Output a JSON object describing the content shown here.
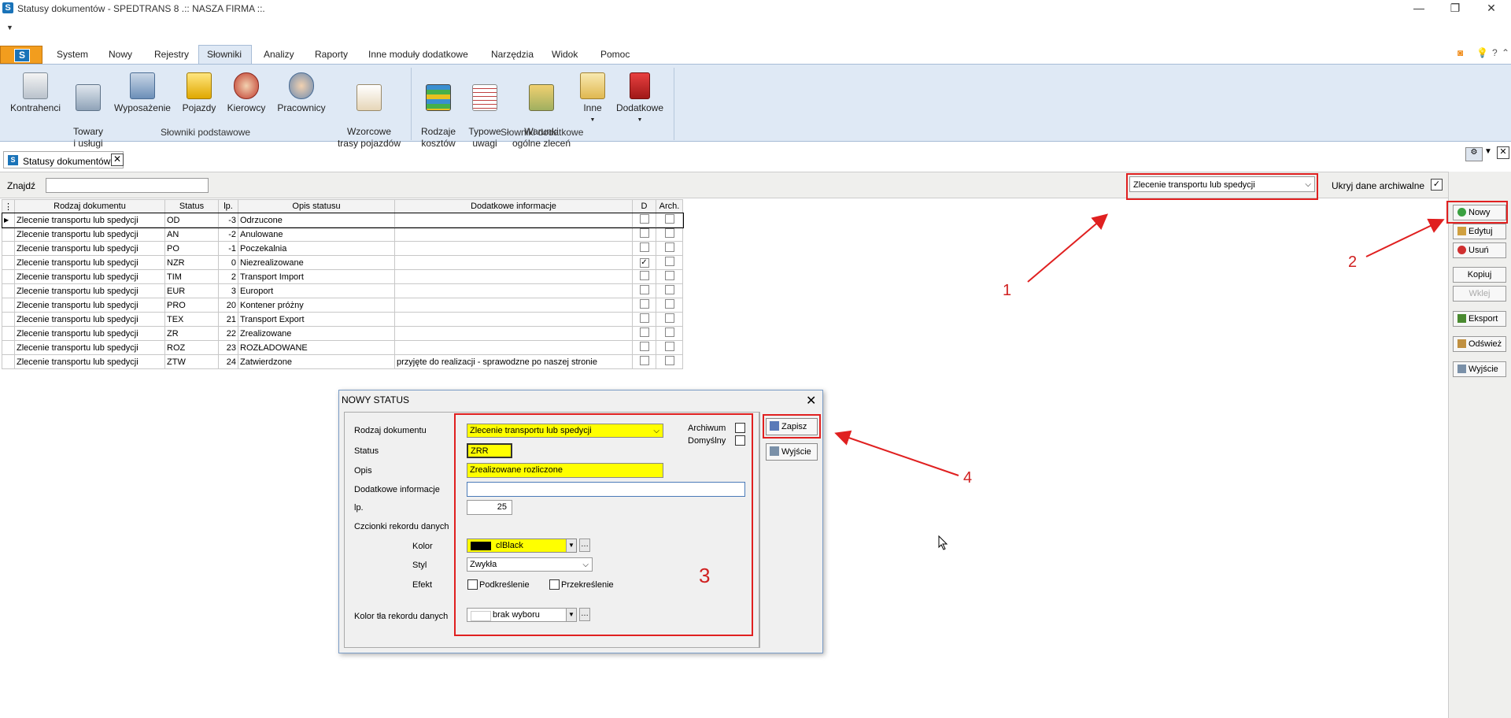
{
  "window": {
    "title": "Statusy dokumentów - SPEDTRANS 8 .:: NASZA FIRMA ::.",
    "minimize": "—",
    "restore": "❐",
    "close": "✕"
  },
  "ribbon": {
    "tabs": [
      "System",
      "Nowy",
      "Rejestry",
      "Słowniki",
      "Analizy",
      "Raporty",
      "Inne moduły dodatkowe",
      "Narzędzia",
      "Widok",
      "Pomoc"
    ],
    "active_tab": "Słowniki",
    "buttons": [
      {
        "label": "Kontrahenci",
        "icon": "book-icon"
      },
      {
        "label": "Towary\ni usługi",
        "icon": "goods-icon"
      },
      {
        "label": "Wyposażenie",
        "icon": "equipment-icon"
      },
      {
        "label": "Pojazdy",
        "icon": "truck-icon"
      },
      {
        "label": "Kierowcy",
        "icon": "driver-icon"
      },
      {
        "label": "Pracownicy",
        "icon": "employees-icon"
      },
      {
        "label": "Wzorcowe\ntrasy pojazdów",
        "icon": "route-icon"
      },
      {
        "label": "Rodzaje\nkosztów",
        "icon": "costs-icon"
      },
      {
        "label": "Typowe\nuwagi",
        "icon": "notes-icon"
      },
      {
        "label": "Warunki\nogólne zleceń",
        "icon": "handshake-icon"
      },
      {
        "label": "Inne",
        "icon": "folder-icon"
      },
      {
        "label": "Dodatkowe",
        "icon": "red-book-icon"
      }
    ],
    "groups": [
      "Słowniki podstawowe",
      "Słowniki dodatkowe"
    ]
  },
  "doc_tab": {
    "label": "Statusy dokumentów"
  },
  "filter": {
    "find_label": "Znajdź",
    "doc_type_selected": "Zlecenie transportu lub spedycji",
    "hide_archived_label": "Ukryj dane archiwalne",
    "hide_archived_check": "✓"
  },
  "grid": {
    "columns": [
      "Rodzaj dokumentu",
      "Status",
      "lp.",
      "Opis statusu",
      "Dodatkowe informacje",
      "D",
      "Arch."
    ],
    "rows": [
      {
        "doc": "Zlecenie transportu lub spedycji",
        "status": "OD",
        "lp": "-3",
        "opis": "Odrzucone",
        "info": "",
        "d": "",
        "arch": ""
      },
      {
        "doc": "Zlecenie transportu lub spedycji",
        "status": "AN",
        "lp": "-2",
        "opis": "Anulowane",
        "info": "",
        "d": "",
        "arch": ""
      },
      {
        "doc": "Zlecenie transportu lub spedycji",
        "status": "PO",
        "lp": "-1",
        "opis": "Poczekalnia",
        "info": "",
        "d": "",
        "arch": ""
      },
      {
        "doc": "Zlecenie transportu lub spedycji",
        "status": "NZR",
        "lp": "0",
        "opis": "Niezrealizowane",
        "info": "",
        "d": "✓",
        "arch": ""
      },
      {
        "doc": "Zlecenie transportu lub spedycji",
        "status": "TIM",
        "lp": "2",
        "opis": "Transport Import",
        "info": "",
        "d": "",
        "arch": ""
      },
      {
        "doc": "Zlecenie transportu lub spedycji",
        "status": "EUR",
        "lp": "3",
        "opis": "Europort",
        "info": "",
        "d": "",
        "arch": ""
      },
      {
        "doc": "Zlecenie transportu lub spedycji",
        "status": "PRO",
        "lp": "20",
        "opis": "Kontener próżny",
        "info": "",
        "d": "",
        "arch": ""
      },
      {
        "doc": "Zlecenie transportu lub spedycji",
        "status": "TEX",
        "lp": "21",
        "opis": "Transport Export",
        "info": "",
        "d": "",
        "arch": ""
      },
      {
        "doc": "Zlecenie transportu lub spedycji",
        "status": "ZR",
        "lp": "22",
        "opis": "Zrealizowane",
        "info": "",
        "d": "",
        "arch": ""
      },
      {
        "doc": "Zlecenie transportu lub spedycji",
        "status": "ROZ",
        "lp": "23",
        "opis": "ROZŁADOWANE",
        "info": "",
        "d": "",
        "arch": ""
      },
      {
        "doc": "Zlecenie transportu lub spedycji",
        "status": "ZTW",
        "lp": "24",
        "opis": "Zatwierdzone",
        "info": "przyjęte do realizacji - sprawodzne po naszej stronie",
        "d": "",
        "arch": ""
      }
    ]
  },
  "side_buttons": {
    "nowy": "Nowy",
    "edytuj": "Edytuj",
    "usun": "Usuń",
    "kopiuj": "Kopiuj",
    "wklej": "Wklej",
    "eksport": "Eksport",
    "odswiez": "Odśwież",
    "wyjscie": "Wyjście"
  },
  "dialog": {
    "title": "NOWY STATUS",
    "labels": {
      "rodzaj": "Rodzaj dokumentu",
      "status": "Status",
      "opis": "Opis",
      "info": "Dodatkowe informacje",
      "lp": "lp.",
      "czcionki": "Czcionki rekordu danych",
      "kolor": "Kolor",
      "styl": "Styl",
      "efekt": "Efekt",
      "kolor_tla": "Kolor tła rekordu danych",
      "archiwum": "Archiwum",
      "domyslny": "Domyślny",
      "podkreslenie": "Podkreślenie",
      "przekreslenie": "Przekreślenie"
    },
    "values": {
      "rodzaj": "Zlecenie transportu lub spedycji",
      "status": "ZRR",
      "opis": "Zrealizowane rozliczone",
      "info": "",
      "lp": "25",
      "kolor": "clBlack",
      "styl": "Zwykła",
      "kolor_tla": "brak wyboru"
    },
    "buttons": {
      "zapisz": "Zapisz",
      "wyjscie": "Wyjście"
    }
  },
  "annotations": {
    "n1": "1",
    "n2": "2",
    "n3": "3",
    "n4": "4",
    "color": "#e02020"
  }
}
